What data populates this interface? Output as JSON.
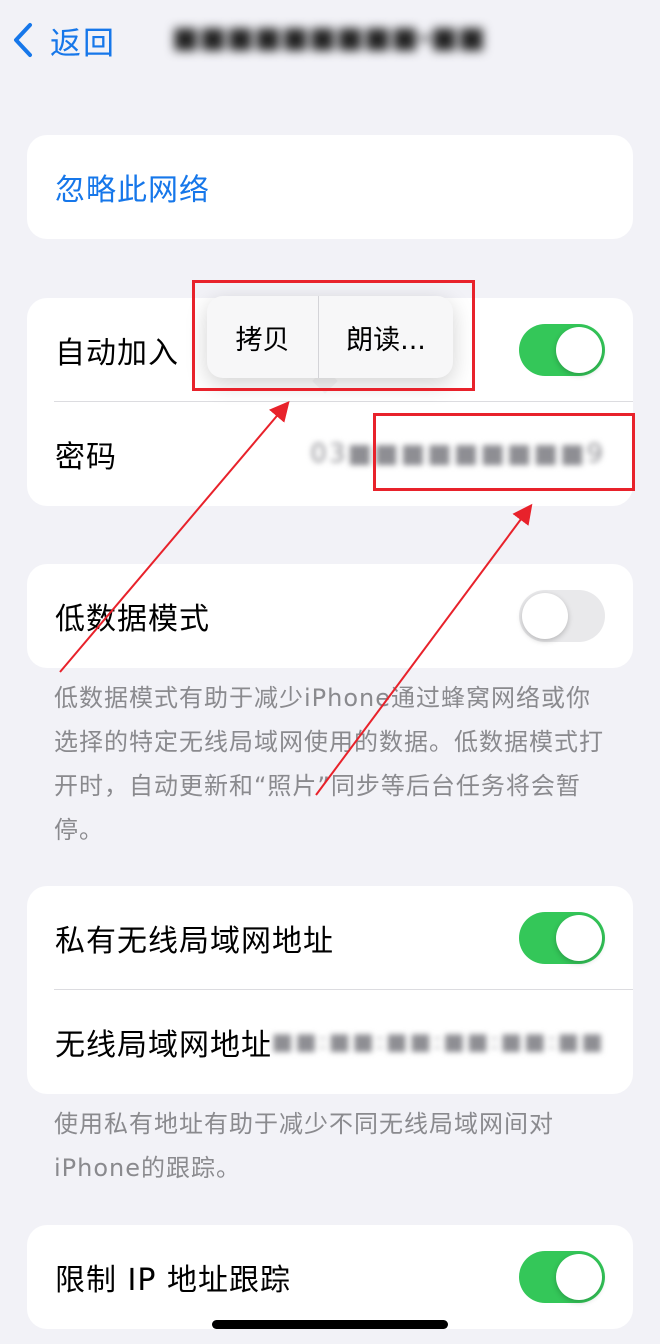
{
  "nav": {
    "back_label": "返回",
    "title": "■■■■■■■■■-■■"
  },
  "forget_network": {
    "label": "忽略此网络"
  },
  "auto_join": {
    "label": "自动加入",
    "toggle_state": "on"
  },
  "password": {
    "label": "密码",
    "value": "03■■■■■■■■■9"
  },
  "context_menu": {
    "items": [
      {
        "label": "拷贝"
      },
      {
        "label": "朗读..."
      }
    ]
  },
  "low_data_mode": {
    "label": "低数据模式",
    "toggle_state": "off",
    "footnote": "低数据模式有助于减少iPhone通过蜂窝网络或你选择的特定无线局域网使用的数据。低数据模式打开时，自动更新和“照片”同步等后台任务将会暂停。"
  },
  "private_address": {
    "label": "私有无线局域网地址",
    "toggle_state": "on"
  },
  "wifi_address": {
    "label": "无线局域网地址",
    "value": "■■:■■:■■:■■:■■:■■"
  },
  "private_address_footnote": "使用私有地址有助于减少不同无线局域网间对iPhone的跟踪。",
  "limit_ip_tracking": {
    "label": "限制 IP 地址跟踪",
    "toggle_state": "on"
  },
  "colors": {
    "accent": "#1677ea",
    "toggle_on": "#34c759",
    "annotation": "#e8222b"
  }
}
